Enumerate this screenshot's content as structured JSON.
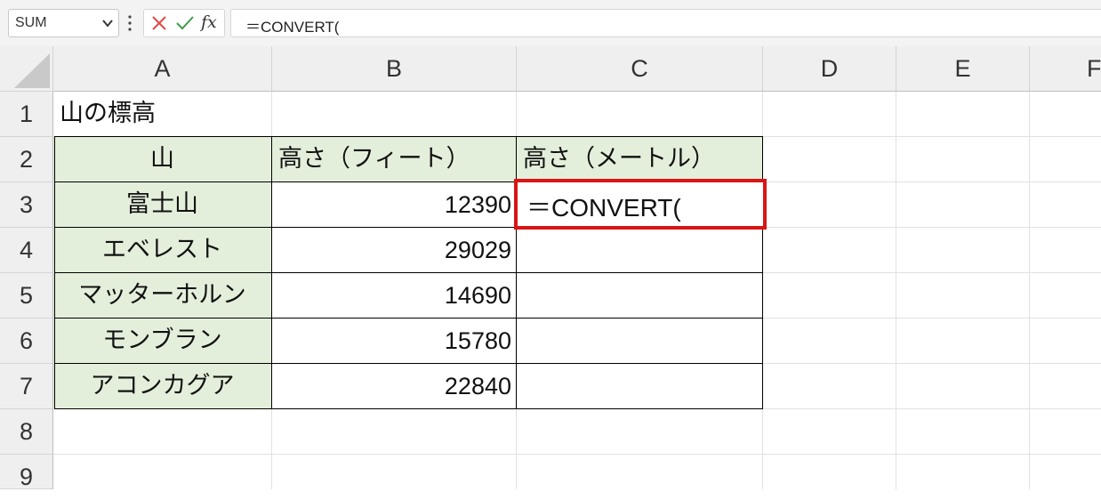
{
  "formula_bar": {
    "name_box": "SUM",
    "cancel_icon": "x-icon",
    "enter_icon": "check-icon",
    "fx_label": "fx",
    "formula": "＝CONVERT("
  },
  "columns": [
    "A",
    "B",
    "C",
    "D",
    "E",
    "F"
  ],
  "rows": [
    "1",
    "2",
    "3",
    "4",
    "5",
    "6",
    "7",
    "8",
    "9"
  ],
  "sheet": {
    "title": "山の標高",
    "headers": [
      "山",
      "高さ（フィート）",
      "高さ（メートル）"
    ],
    "data": [
      {
        "name": "富士山",
        "feet": "12390",
        "meters": "＝CONVERT("
      },
      {
        "name": "エベレスト",
        "feet": "29029",
        "meters": ""
      },
      {
        "name": "マッターホルン",
        "feet": "14690",
        "meters": ""
      },
      {
        "name": "モンブラン",
        "feet": "15780",
        "meters": ""
      },
      {
        "name": "アコンカグア",
        "feet": "22840",
        "meters": ""
      }
    ]
  },
  "colors": {
    "header_fill": "#e3efdb",
    "active_cell_border": "#d91515",
    "cancel_icon": "#e04848",
    "enter_icon": "#3f9b4a"
  }
}
